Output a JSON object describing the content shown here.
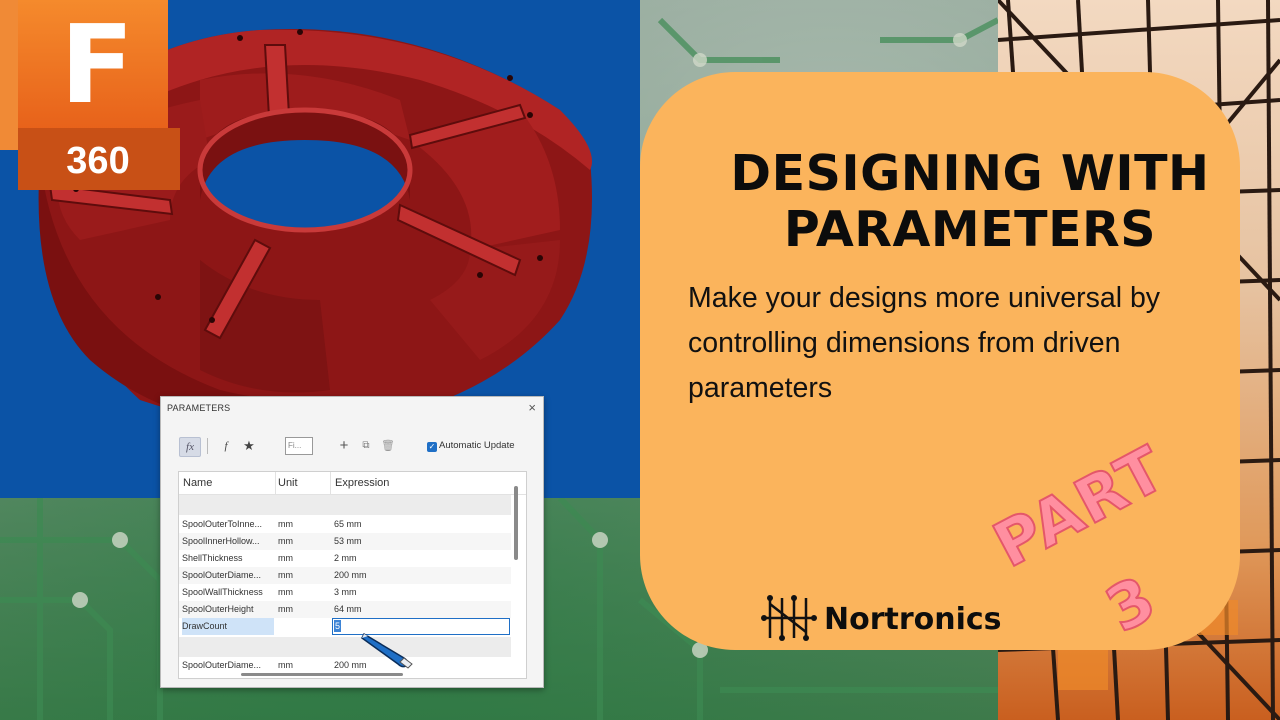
{
  "logo": {
    "letter": "F",
    "number": "360"
  },
  "card": {
    "title_line1": "DESIGNING WITH",
    "title_line2": "PARAMETERS",
    "subtitle": "Make your designs more universal by controlling dimensions from driven parameters",
    "badge": "PART 3",
    "brand": "Nortronics"
  },
  "dialog": {
    "title": "PARAMETERS",
    "close_icon": "×",
    "toolbar": {
      "fx_label": "fx",
      "fx2_label": "f",
      "star_icon": "★",
      "filter_placeholder": "Fi...",
      "add_icon": "+",
      "copy_icon": "⧉",
      "delete_icon": "🗑",
      "auto_update_label": "Automatic Update",
      "auto_update_checked": true
    },
    "columns": [
      "Name",
      "Unit",
      "Expression"
    ],
    "rows": [
      {
        "name": "SpoolOuterToInne...",
        "unit": "mm",
        "expression": "65 mm"
      },
      {
        "name": "SpoolInnerHollow...",
        "unit": "mm",
        "expression": "53 mm"
      },
      {
        "name": "ShellThickness",
        "unit": "mm",
        "expression": "2 mm"
      },
      {
        "name": "SpoolOuterDiame...",
        "unit": "mm",
        "expression": "200 mm"
      },
      {
        "name": "SpoolWallThickness",
        "unit": "mm",
        "expression": "3 mm"
      },
      {
        "name": "SpoolOuterHeight",
        "unit": "mm",
        "expression": "64 mm"
      },
      {
        "name": "DrawCount",
        "unit": "",
        "expression": "5"
      },
      {
        "name": "SpoolOuterDiame...",
        "unit": "mm",
        "expression": "200 mm"
      }
    ]
  },
  "colors": {
    "blue_bg": "#0b53a6",
    "card": "#fbb45c",
    "part_red": "#8b1a1a",
    "logo_orange": "#f58a2c"
  }
}
